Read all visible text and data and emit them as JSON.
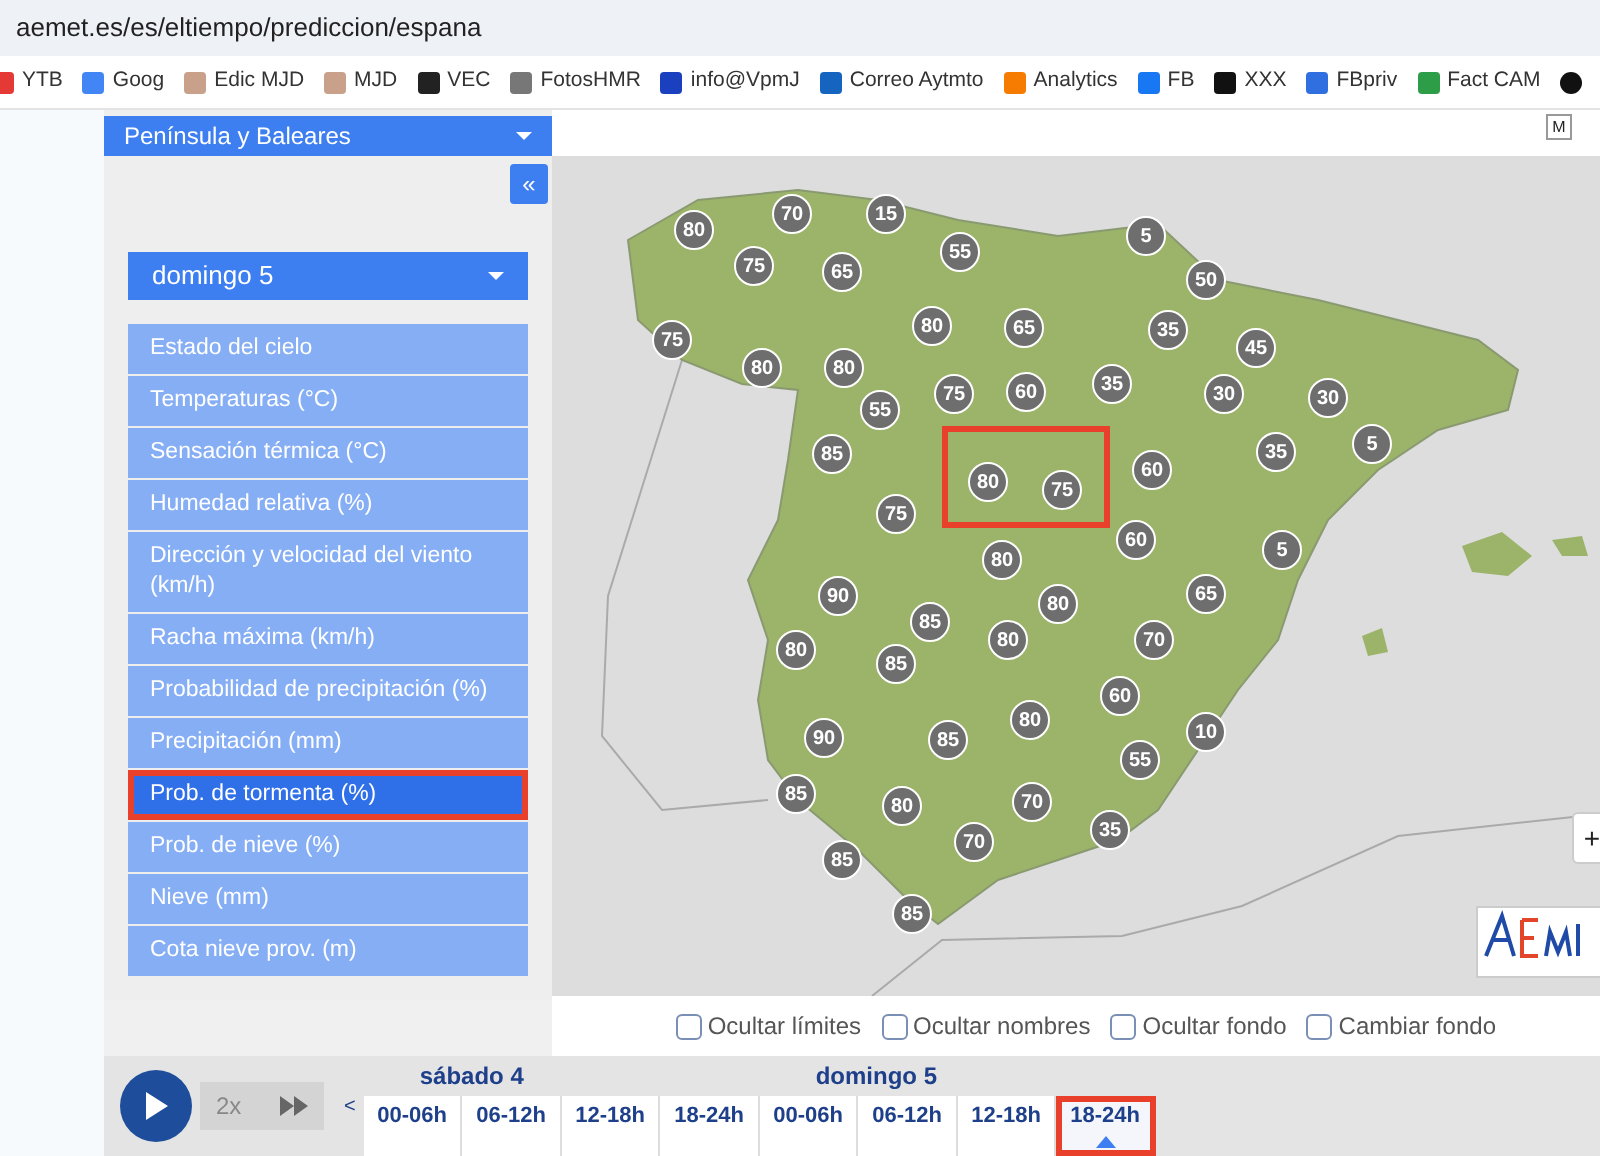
{
  "address_bar": {
    "url": "aemet.es/es/eltiempo/prediccion/espana"
  },
  "bookmarks": [
    {
      "label": "YTB"
    },
    {
      "label": "Goog"
    },
    {
      "label": "Edic MJD"
    },
    {
      "label": "MJD"
    },
    {
      "label": "VEC"
    },
    {
      "label": "FotosHMR"
    },
    {
      "label": "info@VpmJ"
    },
    {
      "label": "Correo Aytmto"
    },
    {
      "label": "Analytics"
    },
    {
      "label": "FB"
    },
    {
      "label": "XXX"
    },
    {
      "label": "FBpriv"
    },
    {
      "label": "Fact CAM"
    }
  ],
  "sidebar": {
    "region_select": "Península y Baleares",
    "collapse_button": "«",
    "day_select": "domingo 5",
    "items": [
      {
        "label": "Estado del cielo",
        "selected": false
      },
      {
        "label": "Temperaturas (°C)",
        "selected": false
      },
      {
        "label": "Sensación térmica (°C)",
        "selected": false
      },
      {
        "label": "Humedad relativa (%)",
        "selected": false
      },
      {
        "label": "Dirección y velocidad del viento (km/h)",
        "selected": false
      },
      {
        "label": "Racha máxima (km/h)",
        "selected": false
      },
      {
        "label": "Probabilidad de precipitación (%)",
        "selected": false
      },
      {
        "label": "Precipitación (mm)",
        "selected": false
      },
      {
        "label": "Prob. de tormenta (%)",
        "selected": true
      },
      {
        "label": "Prob. de nieve (%)",
        "selected": false
      },
      {
        "label": "Nieve (mm)",
        "selected": false
      },
      {
        "label": "Cota nieve prov. (m)",
        "selected": false
      }
    ]
  },
  "map": {
    "layer_button": "M",
    "zoom_button": "+",
    "markers": [
      "80",
      "70",
      "15",
      "55",
      "5",
      "75",
      "65",
      "50",
      "80",
      "65",
      "35",
      "45",
      "75",
      "80",
      "80",
      "75",
      "60",
      "35",
      "30",
      "30",
      "55",
      "85",
      "35",
      "5",
      "80",
      "75",
      "60",
      "75",
      "60",
      "5",
      "80",
      "90",
      "85",
      "80",
      "65",
      "80",
      "85",
      "80",
      "70",
      "60",
      "80",
      "90",
      "85",
      "10",
      "55",
      "85",
      "80",
      "70",
      "35",
      "70",
      "85",
      "85"
    ]
  },
  "options": [
    {
      "label": "Ocultar límites",
      "checked": false
    },
    {
      "label": "Ocultar nombres",
      "checked": false
    },
    {
      "label": "Ocultar fondo",
      "checked": false
    },
    {
      "label": "Cambiar fondo",
      "checked": false
    }
  ],
  "player": {
    "speed": "2x"
  },
  "timeline": {
    "prev": "<",
    "days": [
      {
        "label": "sábado 4",
        "slots": [
          {
            "label": "00-06h",
            "selected": false
          },
          {
            "label": "06-12h",
            "selected": false
          },
          {
            "label": "12-18h",
            "selected": false
          },
          {
            "label": "18-24h",
            "selected": false
          }
        ]
      },
      {
        "label": "domingo 5",
        "slots": [
          {
            "label": "00-06h",
            "selected": false
          },
          {
            "label": "06-12h",
            "selected": false
          },
          {
            "label": "12-18h",
            "selected": false
          },
          {
            "label": "18-24h",
            "selected": true
          }
        ]
      }
    ]
  }
}
